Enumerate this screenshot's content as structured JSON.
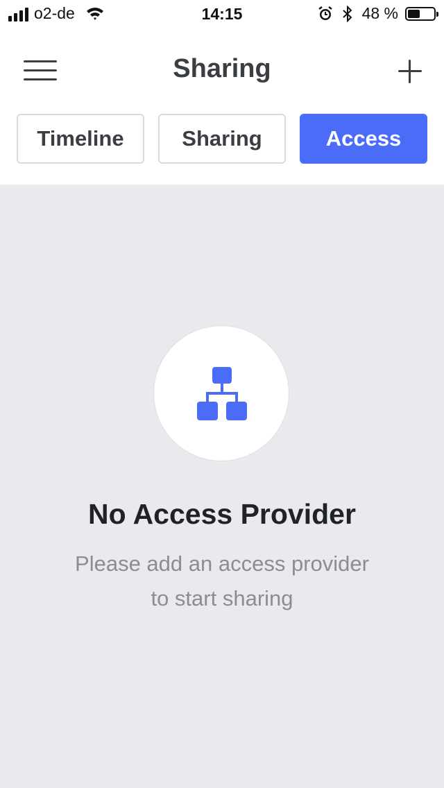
{
  "status_bar": {
    "carrier": "o2-de",
    "time": "14:15",
    "battery_percent": "48 %",
    "battery_level": 0.48,
    "icons": [
      "signal-icon",
      "wifi-icon",
      "alarm-icon",
      "bluetooth-icon",
      "battery-icon"
    ]
  },
  "header": {
    "title": "Sharing",
    "menu_icon": "hamburger-menu-icon",
    "add_icon": "plus-icon"
  },
  "tabs": [
    {
      "label": "Timeline",
      "active": false
    },
    {
      "label": "Sharing",
      "active": false
    },
    {
      "label": "Access",
      "active": true
    }
  ],
  "empty_state": {
    "icon": "hierarchy-icon",
    "title": "No Access Provider",
    "message_line1": "Please add an access provider",
    "message_line2": "to start sharing"
  },
  "colors": {
    "accent": "#4a6cf7",
    "background": "#e9e9ee",
    "text_dark": "#1f2226",
    "text_muted": "#8a8d93"
  }
}
